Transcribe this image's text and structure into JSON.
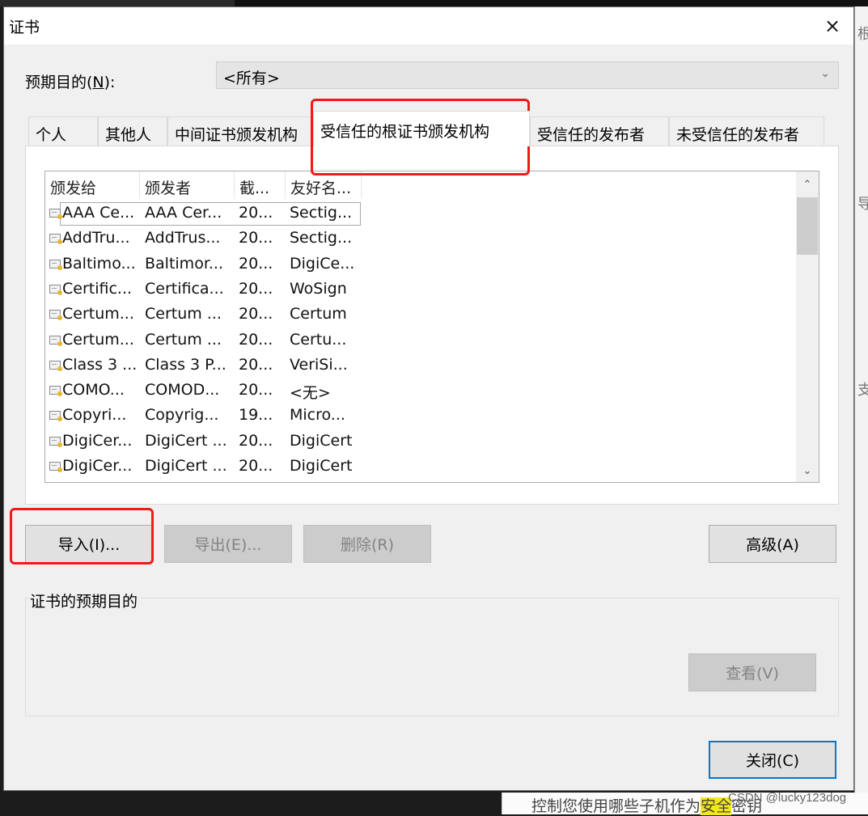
{
  "dialog": {
    "title": "证书",
    "close_icon": "×"
  },
  "purpose": {
    "label_prefix": "预期目的(",
    "label_key": "N",
    "label_suffix": "):",
    "selected_value": "<所有>",
    "dropdown_icon": "⌄"
  },
  "tabs": [
    {
      "label": "个人",
      "active": false
    },
    {
      "label": "其他人",
      "active": false
    },
    {
      "label": "中间证书颁发机构",
      "active": false
    },
    {
      "label": "受信任的根证书颁发机构",
      "active": true
    },
    {
      "label": "受信任的发布者",
      "active": false
    },
    {
      "label": "未受信任的发布者",
      "active": false
    }
  ],
  "list": {
    "columns": [
      "颁发给",
      "颁发者",
      "截...",
      "友好名..."
    ],
    "rows": [
      {
        "issued_to": "AAA Ce...",
        "issued_by": "AAA Cer...",
        "expires": "20...",
        "friendly": "Sectig..."
      },
      {
        "issued_to": "AddTru...",
        "issued_by": "AddTrus...",
        "expires": "20...",
        "friendly": "Sectig..."
      },
      {
        "issued_to": "Baltimo...",
        "issued_by": "Baltimor...",
        "expires": "20...",
        "friendly": "DigiCe..."
      },
      {
        "issued_to": "Certific...",
        "issued_by": "Certifica...",
        "expires": "20...",
        "friendly": "WoSign"
      },
      {
        "issued_to": "Certum...",
        "issued_by": "Certum ...",
        "expires": "20...",
        "friendly": "Certum"
      },
      {
        "issued_to": "Certum...",
        "issued_by": "Certum ...",
        "expires": "20...",
        "friendly": "Certu..."
      },
      {
        "issued_to": "Class 3 ...",
        "issued_by": "Class 3 P...",
        "expires": "20...",
        "friendly": "VeriSi..."
      },
      {
        "issued_to": "COMO...",
        "issued_by": "COMOD...",
        "expires": "20...",
        "friendly": "<无>"
      },
      {
        "issued_to": "Copyri...",
        "issued_by": "Copyrig...",
        "expires": "19...",
        "friendly": "Micro..."
      },
      {
        "issued_to": "DigiCer...",
        "issued_by": "DigiCert ...",
        "expires": "20...",
        "friendly": "DigiCert"
      },
      {
        "issued_to": "DigiCer...",
        "issued_by": "DigiCert ...",
        "expires": "20...",
        "friendly": "DigiCert"
      }
    ],
    "scroll_up_icon": "⌃",
    "scroll_down_icon": "⌄"
  },
  "buttons": {
    "import": "导入(I)...",
    "export": "导出(E)...",
    "remove": "删除(R)",
    "advanced": "高级(A)",
    "view": "查看(V)",
    "close": "关闭(C)"
  },
  "group": {
    "label": "证书的预期目的"
  },
  "background": {
    "side_chars": [
      "根",
      "导",
      "支"
    ],
    "bottom_text_before": "控制您使用哪些子机作为",
    "bottom_text_highlight": "安全",
    "bottom_text_after": "密钥",
    "watermark": "CSDN @lucky123dog"
  },
  "colors": {
    "highlight_annotation": "#f01a1a",
    "default_button_border": "#0078d7"
  }
}
